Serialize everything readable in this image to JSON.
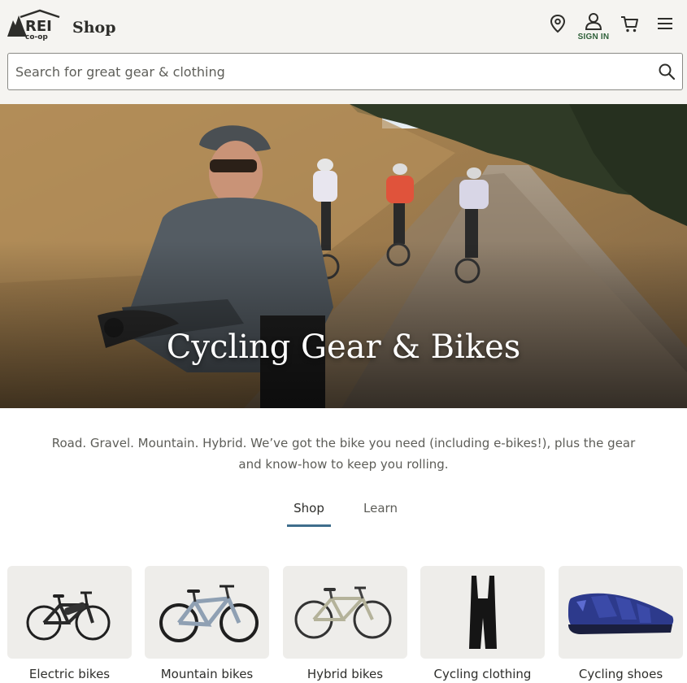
{
  "header": {
    "logo_text": "REI co-op",
    "shop_label": "Shop",
    "signin_label": "SIGN IN",
    "icons": [
      "location-pin-icon",
      "user-icon",
      "cart-icon",
      "menu-icon"
    ]
  },
  "search": {
    "placeholder": "Search for great gear & clothing",
    "icon": "search-icon"
  },
  "hero": {
    "title": "Cycling Gear & Bikes"
  },
  "intro": {
    "text": "Road. Gravel. Mountain. Hybrid. We’ve got the bike you need (including e-bikes!), plus the gear and know-how to keep you rolling."
  },
  "tabs": [
    {
      "label": "Shop",
      "active": true
    },
    {
      "label": "Learn",
      "active": false
    }
  ],
  "categories": [
    {
      "label": "Electric bikes"
    },
    {
      "label": "Mountain bikes"
    },
    {
      "label": "Hybrid bikes"
    },
    {
      "label": "Cycling clothing"
    },
    {
      "label": "Cycling shoes"
    }
  ],
  "colors": {
    "header_bg": "#f5f4f1",
    "brand_green": "#2e5f39",
    "tab_underline": "#3e6d8c",
    "text": "#2e2e2b"
  }
}
